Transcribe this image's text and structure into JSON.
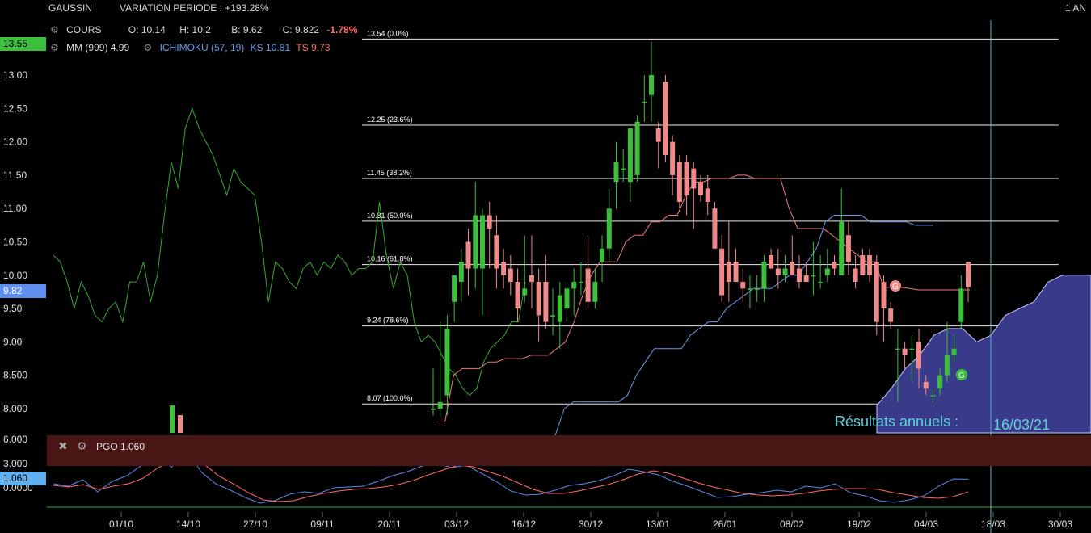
{
  "header": {
    "symbol": "GAUSSIN",
    "variation": "VARIATION PERIODE : +193.28%",
    "period": "1 AN",
    "cours_label": "COURS",
    "open_label": "O:",
    "open": "10.14",
    "high_label": "H:",
    "high": "10.2",
    "low_label": "B:",
    "low": "9.62",
    "close_label": "C:",
    "close": "9.822",
    "change": "-1.78%",
    "mm_label": "MM (999)",
    "mm_value": "4.99",
    "ichimoku_label": "ICHIMOKU (57, 19)",
    "ks_label": "KS",
    "ks_value": "10.81",
    "ts_label": "TS",
    "ts_value": "9.73"
  },
  "price_tags": {
    "high": "13.55",
    "last": "9.82"
  },
  "pgo": {
    "title": "PGO 1.060",
    "value_tag": "1.060"
  },
  "annotation": {
    "text": "Résultats annuels :",
    "date": "16/03/21"
  },
  "colors": {
    "up": "#3cc03c",
    "down": "#f08a8a",
    "ma": "#3aa832",
    "ks": "#f07a7a",
    "ts": "#6a9ae8",
    "cloud": "#3a3a8a",
    "pgo": "#ff6a6a",
    "pgo_fast": "#5a8ae8"
  },
  "chart_data": {
    "type": "candlestick",
    "y_ticks": [
      "13.00",
      "12.50",
      "12.00",
      "11.50",
      "11.00",
      "10.50",
      "10.00",
      "9.50",
      "9.00",
      "8.500",
      "8.000"
    ],
    "y_tick_values": [
      13.0,
      12.5,
      12.0,
      11.5,
      11.0,
      10.5,
      10.0,
      9.5,
      9.0,
      8.5,
      8.0
    ],
    "ylim": [
      7.8,
      13.9
    ],
    "x_ticks": [
      "01/10",
      "14/10",
      "27/10",
      "09/11",
      "20/11",
      "03/12",
      "16/12",
      "30/12",
      "13/01",
      "26/01",
      "08/02",
      "19/02",
      "04/03",
      "18/03",
      "30/03"
    ],
    "fibonacci": [
      {
        "label": "13.54  (0.0%)",
        "value": 13.54
      },
      {
        "label": "12.25  (23.6%)",
        "value": 12.25
      },
      {
        "label": "11.45  (38.2%)",
        "value": 11.45
      },
      {
        "label": "10.81  (50.0%)",
        "value": 10.81
      },
      {
        "label": "10.16  (61.8%)",
        "value": 10.16
      },
      {
        "label": "9.24  (78.6%)",
        "value": 9.24
      },
      {
        "label": "8.07  (100.0%)",
        "value": 8.07
      }
    ],
    "candles": [
      {
        "o": 8.0,
        "h": 8.6,
        "l": 7.9,
        "c": 8.0
      },
      {
        "o": 8.0,
        "h": 9.3,
        "l": 7.9,
        "c": 8.1
      },
      {
        "o": 8.2,
        "h": 9.4,
        "l": 7.9,
        "c": 9.2
      },
      {
        "o": 9.6,
        "h": 10.0,
        "l": 9.3,
        "c": 10.0
      },
      {
        "o": 9.9,
        "h": 10.4,
        "l": 9.6,
        "c": 10.2
      },
      {
        "o": 10.5,
        "h": 10.7,
        "l": 9.7,
        "c": 10.1
      },
      {
        "o": 10.1,
        "h": 11.4,
        "l": 9.8,
        "c": 10.9
      },
      {
        "o": 10.1,
        "h": 11.0,
        "l": 9.4,
        "c": 10.9
      },
      {
        "o": 10.9,
        "h": 11.1,
        "l": 10.1,
        "c": 10.7
      },
      {
        "o": 10.6,
        "h": 10.9,
        "l": 9.8,
        "c": 10.1
      },
      {
        "o": 10.2,
        "h": 10.4,
        "l": 9.8,
        "c": 10.0
      },
      {
        "o": 10.1,
        "h": 10.3,
        "l": 9.7,
        "c": 9.9
      },
      {
        "o": 9.9,
        "h": 10.1,
        "l": 9.3,
        "c": 9.5
      },
      {
        "o": 9.7,
        "h": 10.6,
        "l": 9.6,
        "c": 9.8
      },
      {
        "o": 10.0,
        "h": 10.6,
        "l": 9.5,
        "c": 9.9
      },
      {
        "o": 9.9,
        "h": 10.1,
        "l": 9.0,
        "c": 9.4
      },
      {
        "o": 9.9,
        "h": 10.3,
        "l": 9.2,
        "c": 9.3
      },
      {
        "o": 9.4,
        "h": 9.8,
        "l": 9.1,
        "c": 9.4
      },
      {
        "o": 9.3,
        "h": 9.9,
        "l": 8.9,
        "c": 9.7
      },
      {
        "o": 9.5,
        "h": 9.9,
        "l": 9.3,
        "c": 9.8
      },
      {
        "o": 9.8,
        "h": 10.1,
        "l": 9.4,
        "c": 9.9
      },
      {
        "o": 9.9,
        "h": 10.2,
        "l": 9.7,
        "c": 9.9
      },
      {
        "o": 10.1,
        "h": 10.6,
        "l": 9.5,
        "c": 9.6
      },
      {
        "o": 9.6,
        "h": 10.1,
        "l": 9.5,
        "c": 9.9
      },
      {
        "o": 10.2,
        "h": 10.6,
        "l": 9.9,
        "c": 10.4
      },
      {
        "o": 10.4,
        "h": 11.3,
        "l": 10.2,
        "c": 11.0
      },
      {
        "o": 11.4,
        "h": 12.0,
        "l": 11.0,
        "c": 11.7
      },
      {
        "o": 11.6,
        "h": 11.9,
        "l": 11.4,
        "c": 11.6
      },
      {
        "o": 11.4,
        "h": 12.2,
        "l": 11.1,
        "c": 12.2
      },
      {
        "o": 11.5,
        "h": 12.4,
        "l": 11.4,
        "c": 12.3
      },
      {
        "o": 12.6,
        "h": 13.0,
        "l": 12.3,
        "c": 12.6
      },
      {
        "o": 12.7,
        "h": 13.5,
        "l": 12.3,
        "c": 13.0
      },
      {
        "o": 12.2,
        "h": 12.3,
        "l": 11.6,
        "c": 12.0
      },
      {
        "o": 12.9,
        "h": 13.0,
        "l": 11.7,
        "c": 11.8
      },
      {
        "o": 12.0,
        "h": 12.1,
        "l": 11.2,
        "c": 11.5
      },
      {
        "o": 11.7,
        "h": 11.8,
        "l": 11.0,
        "c": 11.1
      },
      {
        "o": 11.7,
        "h": 11.8,
        "l": 10.9,
        "c": 11.2
      },
      {
        "o": 11.6,
        "h": 11.7,
        "l": 10.7,
        "c": 11.3
      },
      {
        "o": 11.4,
        "h": 11.5,
        "l": 11.1,
        "c": 11.2
      },
      {
        "o": 11.3,
        "h": 11.5,
        "l": 10.9,
        "c": 11.1
      },
      {
        "o": 11.0,
        "h": 11.1,
        "l": 10.4,
        "c": 10.4
      },
      {
        "o": 10.4,
        "h": 10.6,
        "l": 9.6,
        "c": 9.7
      },
      {
        "o": 10.2,
        "h": 10.8,
        "l": 9.6,
        "c": 9.9
      },
      {
        "o": 10.2,
        "h": 10.4,
        "l": 9.9,
        "c": 9.9
      },
      {
        "o": 9.9,
        "h": 10.1,
        "l": 9.6,
        "c": 9.8
      },
      {
        "o": 9.8,
        "h": 10.0,
        "l": 9.5,
        "c": 9.8
      },
      {
        "o": 9.8,
        "h": 10.0,
        "l": 9.6,
        "c": 9.8
      },
      {
        "o": 9.8,
        "h": 10.3,
        "l": 9.6,
        "c": 10.2
      },
      {
        "o": 10.3,
        "h": 10.4,
        "l": 10.1,
        "c": 10.1
      },
      {
        "o": 10.1,
        "h": 10.4,
        "l": 9.8,
        "c": 10.0
      },
      {
        "o": 10.0,
        "h": 10.3,
        "l": 9.9,
        "c": 10.1
      },
      {
        "o": 10.2,
        "h": 10.6,
        "l": 10.0,
        "c": 10.0
      },
      {
        "o": 10.1,
        "h": 10.3,
        "l": 9.8,
        "c": 9.9
      },
      {
        "o": 10.0,
        "h": 10.2,
        "l": 9.9,
        "c": 9.9
      },
      {
        "o": 10.0,
        "h": 10.5,
        "l": 9.7,
        "c": 10.0
      },
      {
        "o": 9.9,
        "h": 10.3,
        "l": 9.8,
        "c": 9.9
      },
      {
        "o": 10.0,
        "h": 10.4,
        "l": 9.9,
        "c": 10.1
      },
      {
        "o": 10.2,
        "h": 10.3,
        "l": 10.0,
        "c": 10.1
      },
      {
        "o": 10.0,
        "h": 11.3,
        "l": 10.0,
        "c": 10.8
      },
      {
        "o": 10.6,
        "h": 10.8,
        "l": 10.0,
        "c": 10.2
      },
      {
        "o": 10.1,
        "h": 10.3,
        "l": 9.8,
        "c": 9.9
      },
      {
        "o": 10.3,
        "h": 10.4,
        "l": 10.0,
        "c": 10.0
      },
      {
        "o": 10.3,
        "h": 10.4,
        "l": 9.9,
        "c": 10.0
      },
      {
        "o": 10.2,
        "h": 10.3,
        "l": 9.1,
        "c": 9.3
      },
      {
        "o": 9.9,
        "h": 10.0,
        "l": 9.0,
        "c": 9.5
      },
      {
        "o": 9.5,
        "h": 9.6,
        "l": 9.2,
        "c": 9.3
      },
      {
        "o": 8.9,
        "h": 9.2,
        "l": 8.1,
        "c": 8.9
      },
      {
        "o": 8.9,
        "h": 9.0,
        "l": 8.6,
        "c": 8.8
      },
      {
        "o": 8.9,
        "h": 9.1,
        "l": 8.4,
        "c": 8.9
      },
      {
        "o": 9.0,
        "h": 9.2,
        "l": 8.3,
        "c": 8.6
      },
      {
        "o": 8.4,
        "h": 8.5,
        "l": 8.2,
        "c": 8.3
      },
      {
        "o": 8.2,
        "h": 8.3,
        "l": 8.1,
        "c": 8.2
      },
      {
        "o": 8.3,
        "h": 8.6,
        "l": 8.2,
        "c": 8.5
      },
      {
        "o": 8.5,
        "h": 9.3,
        "l": 8.4,
        "c": 8.8
      },
      {
        "o": 8.8,
        "h": 9.1,
        "l": 8.7,
        "c": 8.9
      },
      {
        "o": 9.3,
        "h": 10.0,
        "l": 9.2,
        "c": 9.8
      },
      {
        "o": 10.2,
        "h": 10.2,
        "l": 9.6,
        "c": 9.822
      }
    ],
    "ma_series": [
      10.3,
      10.2,
      9.9,
      9.5,
      9.9,
      9.7,
      9.4,
      9.3,
      9.5,
      9.6,
      9.3,
      9.9,
      9.9,
      10.2,
      9.6,
      10.0,
      10.9,
      11.7,
      11.3,
      12.2,
      12.5,
      12.2,
      12.0,
      11.8,
      11.5,
      11.2,
      11.6,
      11.4,
      11.3,
      11.2,
      10.5,
      9.6,
      10.2,
      10.1,
      9.9,
      9.8,
      10.1,
      10.2,
      10.0,
      10.2,
      10.1,
      10.3,
      10.2,
      10.0,
      10.1,
      10.1,
      10.2,
      11.1,
      10.3,
      9.8,
      10.2,
      10.0,
      9.3,
      9.0,
      9.1,
      9.0,
      8.8,
      8.6,
      8.5,
      8.3,
      8.2,
      8.3,
      8.7,
      8.9,
      9.0,
      9.1,
      9.3,
      9.3,
      9.9
    ],
    "ks_series": [
      7.8,
      7.8,
      8.5,
      8.6,
      8.6,
      8.6,
      8.7,
      8.7,
      8.75,
      8.75,
      8.75,
      8.8,
      8.8,
      8.8,
      8.9,
      9.0,
      9.3,
      9.7,
      10.0,
      10.2,
      10.2,
      10.2,
      10.5,
      10.6,
      10.6,
      10.8,
      10.8,
      10.9,
      10.9,
      11.2,
      11.4,
      11.4,
      11.45,
      11.45,
      11.45,
      11.5,
      11.5,
      11.45,
      11.45,
      11.45,
      11.45,
      11.0,
      10.7,
      10.7,
      10.7,
      10.7,
      10.6,
      10.5,
      10.4,
      10.3,
      10.2,
      10.2,
      9.82,
      9.82,
      9.82,
      9.8,
      9.78,
      9.78,
      9.78,
      9.78,
      9.78,
      9.78,
      9.78
    ],
    "ts_series": [
      7.4,
      7.6,
      8.0,
      8.1,
      8.1,
      8.1,
      8.1,
      8.1,
      8.1,
      8.2,
      8.5,
      8.7,
      8.9,
      8.9,
      8.9,
      8.9,
      9.1,
      9.2,
      9.3,
      9.3,
      9.5,
      9.6,
      9.7,
      9.8,
      9.8,
      9.8,
      9.9,
      10.0,
      10.0,
      10.2,
      10.4,
      10.8,
      10.9,
      10.9,
      10.9,
      10.9,
      10.8,
      10.8,
      10.8,
      10.8,
      10.8,
      10.75,
      10.75,
      10.75
    ],
    "cloud_series": [
      8.05,
      8.3,
      8.6,
      8.8,
      9.1,
      9.2,
      9.2,
      9.0,
      9.1,
      9.4,
      9.5,
      9.6,
      9.9,
      10.0,
      10.0,
      10.0
    ],
    "pgo": {
      "ylim": [
        -2.5,
        7.0
      ],
      "ticks": [
        "6.000",
        "3.000",
        "0.0000"
      ],
      "tick_values": [
        6.0,
        3.0,
        0.0
      ],
      "signal": [
        0.3,
        0.1,
        0.4,
        -0.2,
        0.2,
        0.5,
        1.2,
        2.5,
        3.5,
        3.8,
        3.0,
        1.5,
        0.5,
        -0.6,
        -1.5,
        -1.7,
        -1.6,
        -1.1,
        -0.7,
        -0.4,
        -0.2,
        -0.1,
        0.1,
        0.4,
        0.9,
        1.6,
        2.2,
        2.8,
        2.6,
        2.0,
        1.4,
        0.6,
        -0.2,
        -0.7,
        -0.7,
        -0.4,
        0.0,
        0.4,
        1.0,
        1.7,
        2.1,
        1.8,
        1.2,
        0.6,
        0.1,
        -0.3,
        -0.7,
        -0.9,
        -1.0,
        -0.9,
        -0.7,
        -0.4,
        -0.2,
        -0.1,
        -0.1,
        -0.2,
        -0.6,
        -0.9,
        -1.2,
        -1.3,
        -1.1,
        -0.5
      ],
      "fast": [
        0.5,
        0.2,
        1.0,
        -0.5,
        0.8,
        1.5,
        2.8,
        4.6,
        2.5,
        4.8,
        2.0,
        0.5,
        -0.3,
        -1.2,
        -1.9,
        -1.6,
        -0.8,
        -0.5,
        -0.7,
        0.0,
        0.1,
        0.2,
        0.8,
        1.5,
        2.0,
        2.7,
        3.0,
        2.5,
        2.8,
        1.8,
        0.8,
        -0.4,
        -0.9,
        -0.8,
        -0.3,
        0.3,
        0.5,
        0.9,
        1.5,
        2.3,
        2.0,
        1.6,
        0.8,
        0.2,
        -0.5,
        -1.2,
        -1.1,
        -0.8,
        -0.6,
        -0.3,
        -0.5,
        0.2,
        0.0,
        0.5,
        -0.6,
        -1.0,
        -1.6,
        -1.8,
        -1.5,
        -1.0,
        0.2,
        1.1,
        1.06
      ]
    }
  }
}
